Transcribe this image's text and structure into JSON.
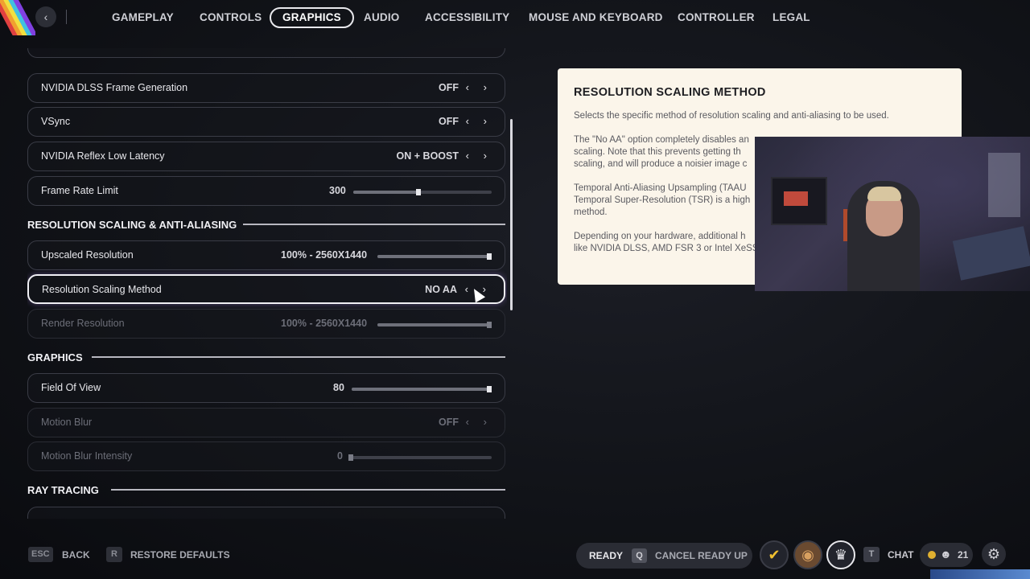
{
  "nav": {
    "back_icon": "chevron-left-icon",
    "tabs": [
      "GAMEPLAY",
      "CONTROLS",
      "GRAPHICS",
      "AUDIO",
      "ACCESSIBILITY",
      "MOUSE AND KEYBOARD",
      "CONTROLLER",
      "LEGAL"
    ],
    "active_tab": "GRAPHICS"
  },
  "settings": {
    "rows": [
      {
        "label": "NVIDIA DLSS Frame Generation",
        "value": "OFF"
      },
      {
        "label": "VSync",
        "value": "OFF"
      },
      {
        "label": "NVIDIA Reflex Low Latency",
        "value": "ON + BOOST"
      },
      {
        "label": "Frame Rate Limit",
        "value": "300",
        "level": 0.47
      },
      {
        "label": "Upscaled Resolution",
        "value": "100% - 2560X1440",
        "level": 1.0
      },
      {
        "label": "Resolution Scaling Method",
        "value": "NO AA"
      },
      {
        "label": "Render Resolution",
        "value": "100% - 2560X1440",
        "level": 1.0
      },
      {
        "label": "Field Of View",
        "value": "80",
        "level": 1.0
      },
      {
        "label": "Motion Blur",
        "value": "OFF"
      },
      {
        "label": "Motion Blur Intensity",
        "value": "0",
        "level": 0.0
      }
    ],
    "sections": [
      "RESOLUTION SCALING & ANTI-ALIASING",
      "GRAPHICS",
      "RAY TRACING"
    ]
  },
  "info": {
    "title": "RESOLUTION SCALING METHOD",
    "p1": "Selects the specific method of resolution scaling and anti-aliasing to be used.",
    "p2": "The \"No AA\" option completely disables an",
    "p2b": "scaling. Note that this prevents getting th",
    "p2c": "scaling, and will produce a noisier image c",
    "p3": "Temporal Anti-Aliasing Upsampling (TAAU",
    "p3b": "Temporal Super-Resolution (TSR) is a high",
    "p3c": "method.",
    "p4": "Depending on your hardware, additional h",
    "p4b": "like NVIDIA DLSS, AMD FSR 3 or Intel XeSS"
  },
  "bottom": {
    "esc_key": "ESC",
    "back": "BACK",
    "r_key": "R",
    "restore": "RESTORE DEFAULTS",
    "ready": "READY",
    "q_key": "Q",
    "cancel_ready": "CANCEL READY UP",
    "chat_key": "T",
    "chat": "CHAT",
    "friends_count": "21"
  },
  "colors": {
    "accent": "#e8e8ec",
    "panel": "#fbf5ea",
    "background": "#111318"
  }
}
